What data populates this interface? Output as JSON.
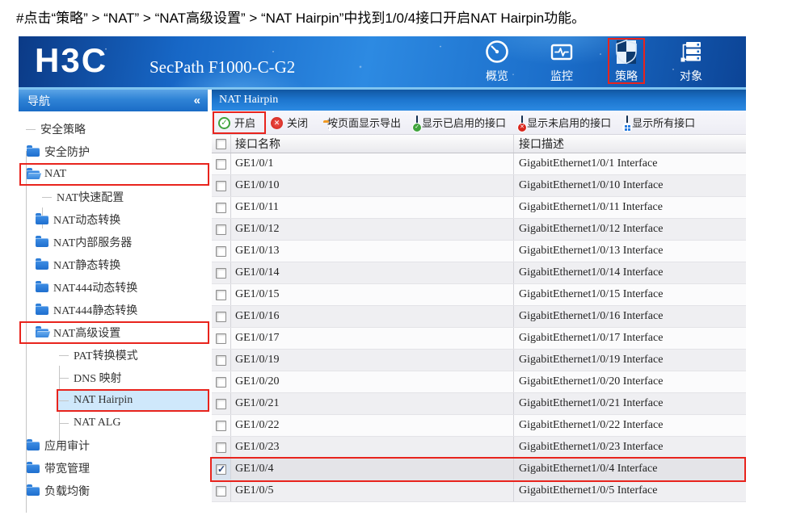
{
  "caption": "#点击“策略” > “NAT” > “NAT高级设置” > “NAT Hairpin”中找到1/0/4接口开启NAT Hairpin功能。",
  "colors": {
    "brand_blue": "#1a74d2",
    "annotation_red": "#e8241d",
    "selected_tree_bg": "#cfe8fb"
  },
  "header": {
    "logo": "H3C",
    "product": "SecPath F1000-C-G2",
    "nav": [
      {
        "id": "overview",
        "label": "概览",
        "icon": "gauge-icon"
      },
      {
        "id": "monitor",
        "label": "监控",
        "icon": "monitor-icon"
      },
      {
        "id": "policy",
        "label": "策略",
        "icon": "shield-icon",
        "annotated": true
      },
      {
        "id": "objects",
        "label": "对象",
        "icon": "objects-icon"
      }
    ]
  },
  "sidebar": {
    "title": "导航",
    "collapse_icon": "«",
    "items": [
      {
        "id": "security-policy",
        "label": "安全策略",
        "level": 1,
        "type": "leaf"
      },
      {
        "id": "security-protection",
        "label": "安全防护",
        "level": 1,
        "type": "folder"
      },
      {
        "id": "nat",
        "label": "NAT",
        "level": 1,
        "type": "folder-open",
        "annotated": true
      },
      {
        "id": "nat-quick-config",
        "label": "NAT快速配置",
        "level": 2,
        "type": "leaf"
      },
      {
        "id": "nat-dynamic",
        "label": "NAT动态转换",
        "level": 2,
        "type": "folder"
      },
      {
        "id": "nat-internal-server",
        "label": "NAT内部服务器",
        "level": 2,
        "type": "folder"
      },
      {
        "id": "nat-static",
        "label": "NAT静态转换",
        "level": 2,
        "type": "folder"
      },
      {
        "id": "nat444-dynamic",
        "label": "NAT444动态转换",
        "level": 2,
        "type": "folder"
      },
      {
        "id": "nat444-static",
        "label": "NAT444静态转换",
        "level": 2,
        "type": "folder"
      },
      {
        "id": "nat-advanced",
        "label": "NAT高级设置",
        "level": 2,
        "type": "folder-open",
        "annotated": true
      },
      {
        "id": "pat-mode",
        "label": "PAT转换模式",
        "level": 3,
        "type": "leaf"
      },
      {
        "id": "dns-mapping",
        "label": "DNS 映射",
        "level": 3,
        "type": "leaf"
      },
      {
        "id": "nat-hairpin",
        "label": "NAT Hairpin",
        "level": 3,
        "type": "leaf",
        "selected": true,
        "annotated": true
      },
      {
        "id": "nat-alg",
        "label": "NAT ALG",
        "level": 3,
        "type": "leaf"
      },
      {
        "id": "app-audit",
        "label": "应用审计",
        "level": 1,
        "type": "folder"
      },
      {
        "id": "bandwidth-mgmt",
        "label": "带宽管理",
        "level": 1,
        "type": "folder"
      },
      {
        "id": "load-balance",
        "label": "负载均衡",
        "level": 1,
        "type": "folder"
      }
    ]
  },
  "main": {
    "title": "NAT Hairpin",
    "toolbar": [
      {
        "id": "enable",
        "label": "开启",
        "icon": "enable-icon",
        "annotated": true
      },
      {
        "id": "disable",
        "label": "关闭",
        "icon": "disable-icon"
      },
      {
        "id": "export",
        "label": "按页面显示导出",
        "icon": "export-icon"
      },
      {
        "id": "show-enabled",
        "label": "显示已启用的接口",
        "icon": "show-enabled-icon"
      },
      {
        "id": "show-disabled",
        "label": "显示未启用的接口",
        "icon": "show-disabled-icon"
      },
      {
        "id": "show-all",
        "label": "显示所有接口",
        "icon": "show-all-icon"
      }
    ],
    "table": {
      "columns": [
        "接口名称",
        "接口描述"
      ],
      "rows": [
        {
          "name": "GE1/0/1",
          "desc": "GigabitEthernet1/0/1 Interface",
          "checked": false
        },
        {
          "name": "GE1/0/10",
          "desc": "GigabitEthernet1/0/10 Interface",
          "checked": false
        },
        {
          "name": "GE1/0/11",
          "desc": "GigabitEthernet1/0/11 Interface",
          "checked": false
        },
        {
          "name": "GE1/0/12",
          "desc": "GigabitEthernet1/0/12 Interface",
          "checked": false
        },
        {
          "name": "GE1/0/13",
          "desc": "GigabitEthernet1/0/13 Interface",
          "checked": false
        },
        {
          "name": "GE1/0/14",
          "desc": "GigabitEthernet1/0/14 Interface",
          "checked": false
        },
        {
          "name": "GE1/0/15",
          "desc": "GigabitEthernet1/0/15 Interface",
          "checked": false
        },
        {
          "name": "GE1/0/16",
          "desc": "GigabitEthernet1/0/16 Interface",
          "checked": false
        },
        {
          "name": "GE1/0/17",
          "desc": "GigabitEthernet1/0/17 Interface",
          "checked": false
        },
        {
          "name": "GE1/0/19",
          "desc": "GigabitEthernet1/0/19 Interface",
          "checked": false
        },
        {
          "name": "GE1/0/20",
          "desc": "GigabitEthernet1/0/20 Interface",
          "checked": false
        },
        {
          "name": "GE1/0/21",
          "desc": "GigabitEthernet1/0/21 Interface",
          "checked": false
        },
        {
          "name": "GE1/0/22",
          "desc": "GigabitEthernet1/0/22 Interface",
          "checked": false
        },
        {
          "name": "GE1/0/23",
          "desc": "GigabitEthernet1/0/23 Interface",
          "checked": false
        },
        {
          "name": "GE1/0/4",
          "desc": "GigabitEthernet1/0/4 Interface",
          "checked": true,
          "selected": true,
          "annotated": true
        },
        {
          "name": "GE1/0/5",
          "desc": "GigabitEthernet1/0/5 Interface",
          "checked": false
        }
      ]
    }
  }
}
